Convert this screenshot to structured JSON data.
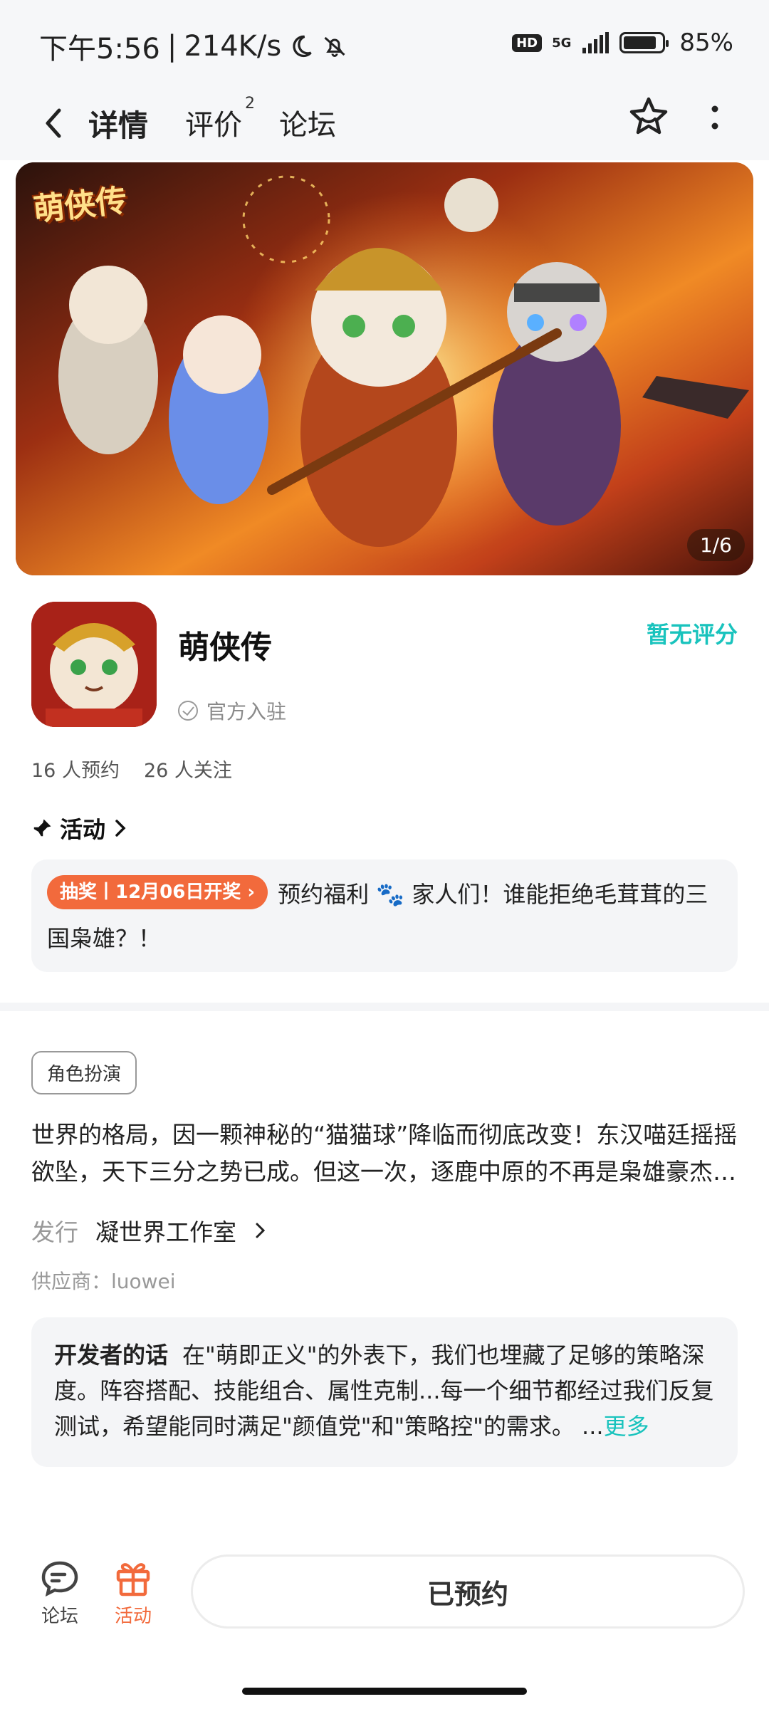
{
  "status_bar": {
    "time": "下午5:56",
    "speed": "214K/s",
    "hd": "HD",
    "network": "5G",
    "battery": "85%"
  },
  "nav": {
    "tabs": [
      {
        "label": "详情"
      },
      {
        "label": "评价",
        "badge": "2"
      },
      {
        "label": "论坛"
      }
    ]
  },
  "banner": {
    "logo_text": "萌侠传",
    "counter": "1/6"
  },
  "game": {
    "name": "萌侠传",
    "official": "官方入驻",
    "rating": "暂无评分",
    "reservations": "16 人预约",
    "followers": "26 人关注"
  },
  "activity": {
    "heading": "活动",
    "tag": "抽奖丨12月06日开奖",
    "text_a": "预约福利 ",
    "paw": "🐾",
    "text_b": " 家人们！谁能拒绝毛茸茸的三国枭雄？！"
  },
  "details": {
    "genre": "角色扮演",
    "description": "世界的格局，因一颗神秘的“猫猫球”降临而彻底改变！东汉喵廷摇摇欲坠，天下三分之势已成。但这一次，逐鹿中原的不再是枭雄豪杰…",
    "publisher_label": "发行",
    "publisher_value": "凝世界工作室",
    "supplier": "供应商：luowei"
  },
  "developer": {
    "label": "开发者的话",
    "text": "在\"萌即正义\"的外表下，我们也埋藏了足够的策略深度。阵容搭配、技能组合、属性克制...每一个细节都经过我们反复测试，希望能同时满足\"颜值党\"和\"策略控\"的需求。 ...",
    "more": "更多"
  },
  "bottom_bar": {
    "forum": "论坛",
    "event": "活动",
    "reserve_button": "已预约"
  },
  "colors": {
    "accent": "#19c3bd",
    "orange": "#f26a3c"
  }
}
